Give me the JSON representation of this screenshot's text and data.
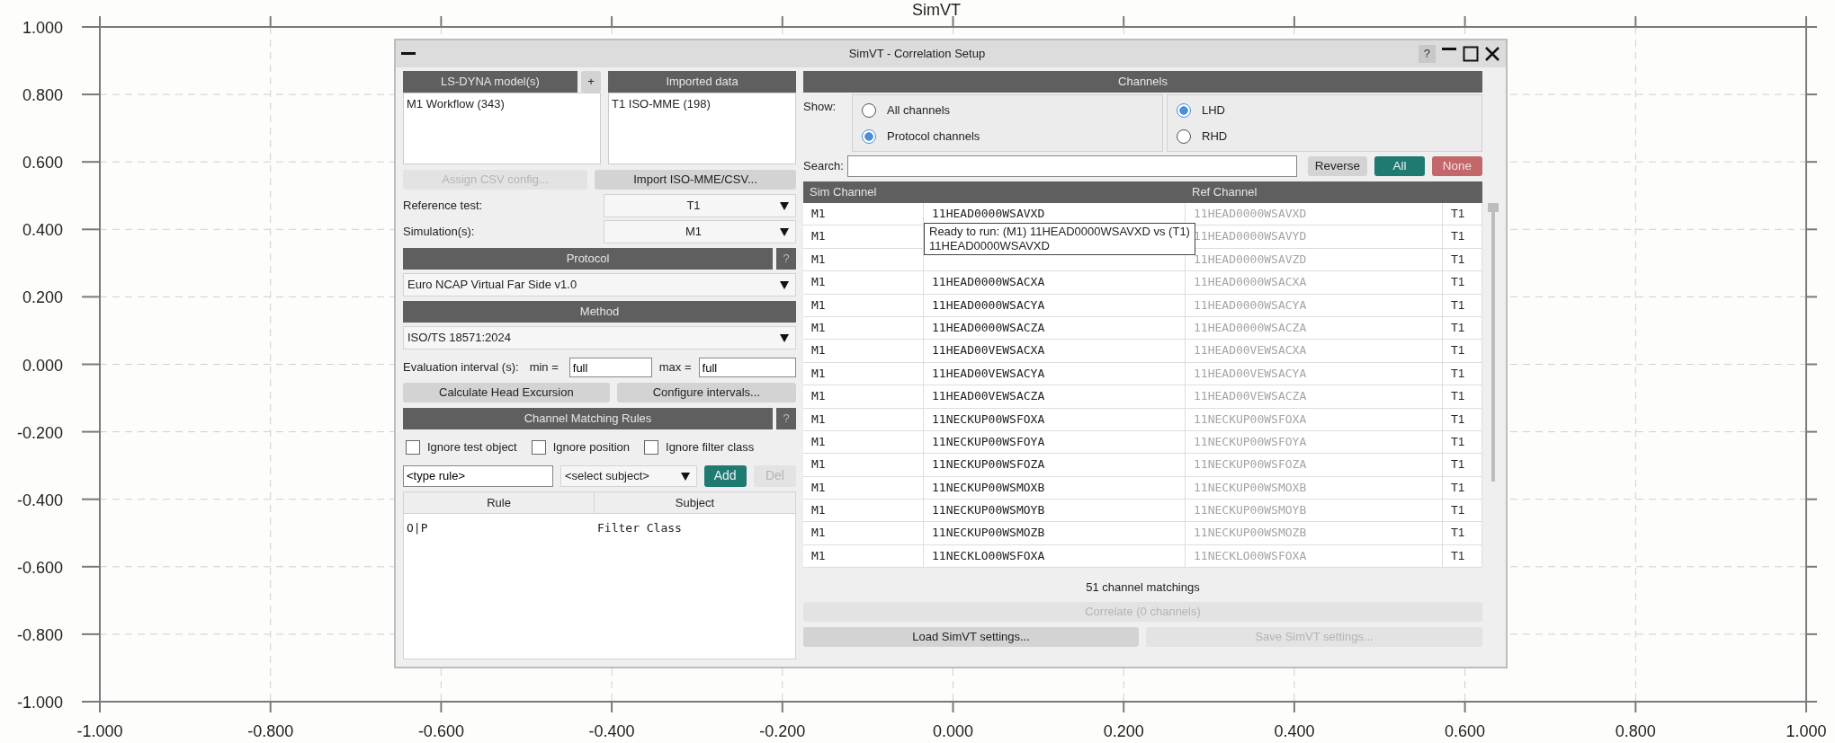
{
  "plot": {
    "title": "SimVT",
    "chart_data": {
      "type": "line",
      "grid": true,
      "xlim": [
        -1,
        1
      ],
      "ylim": [
        -1,
        1
      ],
      "xticks": [
        {
          "value": -1,
          "label": "-1.000"
        },
        {
          "value": -0.8,
          "label": "-0.800"
        },
        {
          "value": -0.6,
          "label": "-0.600"
        },
        {
          "value": -0.4,
          "label": "-0.400"
        },
        {
          "value": -0.2,
          "label": "-0.200"
        },
        {
          "value": 0,
          "label": "0.000"
        },
        {
          "value": 0.2,
          "label": "0.200"
        },
        {
          "value": 0.4,
          "label": "0.400"
        },
        {
          "value": 0.6,
          "label": "0.600"
        },
        {
          "value": 0.8,
          "label": "0.800"
        },
        {
          "value": 1,
          "label": "1.000"
        }
      ],
      "yticks": [
        {
          "value": -1,
          "label": "-1.000"
        },
        {
          "value": -0.8,
          "label": "-0.800"
        },
        {
          "value": -0.6,
          "label": "-0.600"
        },
        {
          "value": -0.4,
          "label": "-0.400"
        },
        {
          "value": -0.2,
          "label": "-0.200"
        },
        {
          "value": 0,
          "label": "0.000"
        },
        {
          "value": 0.2,
          "label": "0.200"
        },
        {
          "value": 0.4,
          "label": "0.400"
        },
        {
          "value": 0.6,
          "label": "0.600"
        },
        {
          "value": 0.8,
          "label": "0.800"
        },
        {
          "value": 1,
          "label": "1.000"
        }
      ]
    }
  },
  "dialog": {
    "title": "SimVT - Correlation Setup",
    "help": "?",
    "models": {
      "header": "LS-DYNA model(s)",
      "add": "+",
      "items": [
        "M1 Workflow (343)"
      ]
    },
    "imported": {
      "header": "Imported data",
      "items": [
        "T1 ISO-MME (198)"
      ]
    },
    "file_buttons": [
      {
        "label": "Assign CSV config...",
        "disabled": true
      },
      {
        "label": "Import ISO-MME/CSV...",
        "disabled": false
      }
    ],
    "selects": [
      {
        "label": "Reference test:",
        "value": "T1"
      },
      {
        "label": "Simulation(s):",
        "value": "M1"
      }
    ],
    "protocol": {
      "header": "Protocol",
      "help": "?",
      "value": "Euro NCAP Virtual Far Side v1.0"
    },
    "method": {
      "header": "Method",
      "value": "ISO/TS 18571:2024"
    },
    "evaluation": {
      "label": "Evaluation interval (s):",
      "min_label": "min =",
      "min": "full",
      "max_label": "max =",
      "max": "full"
    },
    "calc_buttons": [
      {
        "label": "Calculate Head Excursion",
        "disabled": false
      },
      {
        "label": "Configure intervals...",
        "disabled": false
      }
    ],
    "rules": {
      "header": "Channel Matching Rules",
      "help": "?",
      "options": [
        {
          "label": "Ignore test object",
          "checked": false
        },
        {
          "label": "Ignore position",
          "checked": false
        },
        {
          "label": "Ignore filter class",
          "checked": false
        }
      ],
      "rule": "<type rule>",
      "subject": "<select subject>",
      "buttons": [
        {
          "label": "Add",
          "disabled": false
        },
        {
          "label": "Del",
          "disabled": true
        }
      ],
      "columns": [
        "Rule",
        "Subject"
      ],
      "rows": [
        [
          "O|P",
          "Filter Class"
        ]
      ]
    },
    "channels": {
      "header": "Channels",
      "show_label": "Show:",
      "scope": [
        {
          "label": "All channels",
          "selected": false
        },
        {
          "label": "Protocol channels",
          "selected": true
        }
      ],
      "side": [
        {
          "label": "LHD",
          "selected": true
        },
        {
          "label": "RHD",
          "selected": false
        }
      ],
      "search_label": "Search:",
      "buttons": [
        {
          "label": "Reverse",
          "kind": "plain"
        },
        {
          "label": "All",
          "kind": "all"
        },
        {
          "label": "None",
          "kind": "none"
        }
      ],
      "columns": [
        "Sim Channel",
        "Ref Channel"
      ],
      "rows": [
        {
          "model": "M1",
          "sim": "11HEAD0000WSAVXD",
          "ref": "11HEAD0000WSAVXD",
          "test": "T1"
        },
        {
          "model": "M1",
          "ref": "11HEAD0000WSAVYD",
          "test": "T1"
        },
        {
          "model": "M1",
          "ref": "11HEAD0000WSAVZD",
          "test": "T1"
        },
        {
          "model": "M1",
          "sim": "11HEAD0000WSACXA",
          "ref": "11HEAD0000WSACXA",
          "test": "T1"
        },
        {
          "model": "M1",
          "sim": "11HEAD0000WSACYA",
          "ref": "11HEAD0000WSACYA",
          "test": "T1"
        },
        {
          "model": "M1",
          "sim": "11HEAD0000WSACZA",
          "ref": "11HEAD0000WSACZA",
          "test": "T1"
        },
        {
          "model": "M1",
          "sim": "11HEAD00VEWSACXA",
          "ref": "11HEAD00VEWSACXA",
          "test": "T1"
        },
        {
          "model": "M1",
          "sim": "11HEAD00VEWSACYA",
          "ref": "11HEAD00VEWSACYA",
          "test": "T1"
        },
        {
          "model": "M1",
          "sim": "11HEAD00VEWSACZA",
          "ref": "11HEAD00VEWSACZA",
          "test": "T1"
        },
        {
          "model": "M1",
          "sim": "11NECKUP00WSFOXA",
          "ref": "11NECKUP00WSFOXA",
          "test": "T1"
        },
        {
          "model": "M1",
          "sim": "11NECKUP00WSFOYA",
          "ref": "11NECKUP00WSFOYA",
          "test": "T1"
        },
        {
          "model": "M1",
          "sim": "11NECKUP00WSFOZA",
          "ref": "11NECKUP00WSFOZA",
          "test": "T1"
        },
        {
          "model": "M1",
          "sim": "11NECKUP00WSMOXB",
          "ref": "11NECKUP00WSMOXB",
          "test": "T1"
        },
        {
          "model": "M1",
          "sim": "11NECKUP00WSMOYB",
          "ref": "11NECKUP00WSMOYB",
          "test": "T1"
        },
        {
          "model": "M1",
          "sim": "11NECKUP00WSMOZB",
          "ref": "11NECKUP00WSMOZB",
          "test": "T1"
        },
        {
          "model": "M1",
          "sim": "11NECKLO00WSFOXA",
          "ref": "11NECKLO00WSFOXA",
          "test": "T1"
        }
      ],
      "tooltip": [
        "Ready to run: (M1) 11HEAD0000WSAVXD vs (T1)",
        "11HEAD0000WSAVXD"
      ],
      "count": "51 channel matchings",
      "correlate": {
        "label": "Correlate (0 channels)",
        "disabled": true
      },
      "settings_buttons": [
        {
          "label": "Load SimVT settings...",
          "disabled": false
        },
        {
          "label": "Save SimVT settings...",
          "disabled": true
        }
      ]
    }
  }
}
